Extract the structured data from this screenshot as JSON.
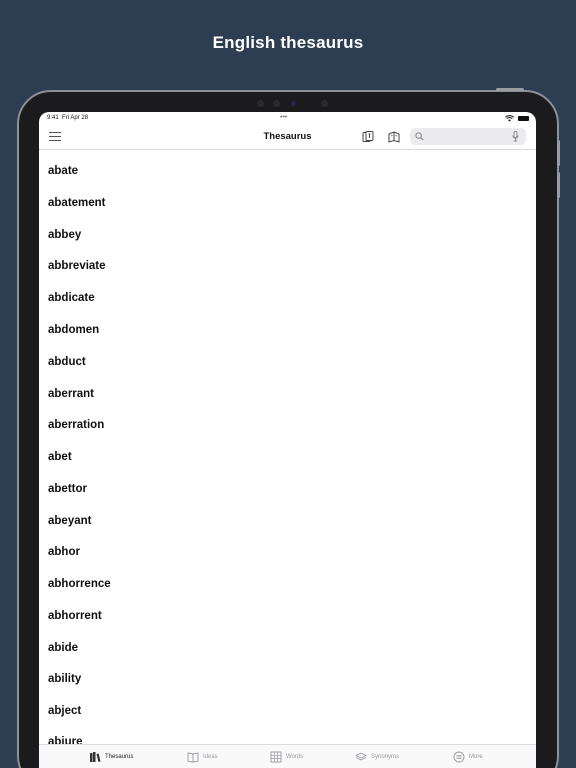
{
  "promo": {
    "headline": "English thesaurus"
  },
  "status_bar": {
    "time": "9:41",
    "date": "Fri Apr 28",
    "dots": "•••"
  },
  "nav": {
    "title": "Thesaurus",
    "search_placeholder": ""
  },
  "words": [
    "abate",
    "abatement",
    "abbey",
    "abbreviate",
    "abdicate",
    "abdomen",
    "abduct",
    "aberrant",
    "aberration",
    "abet",
    "abettor",
    "abeyant",
    "abhor",
    "abhorrence",
    "abhorrent",
    "abide",
    "ability",
    "abject",
    "abjure"
  ],
  "tabs": [
    {
      "label": "Thesaurus",
      "icon": "books-icon",
      "active": true
    },
    {
      "label": "Ideas",
      "icon": "book-open-icon",
      "active": false
    },
    {
      "label": "Words",
      "icon": "grid-icon",
      "active": false
    },
    {
      "label": "Synonyms",
      "icon": "layers-icon",
      "active": false
    },
    {
      "label": "More",
      "icon": "more-circle-icon",
      "active": false
    }
  ],
  "colors": {
    "background": "#2e3e52",
    "screen": "#ffffff",
    "tab_active": "#222222",
    "tab_inactive": "#9a9aa0"
  }
}
